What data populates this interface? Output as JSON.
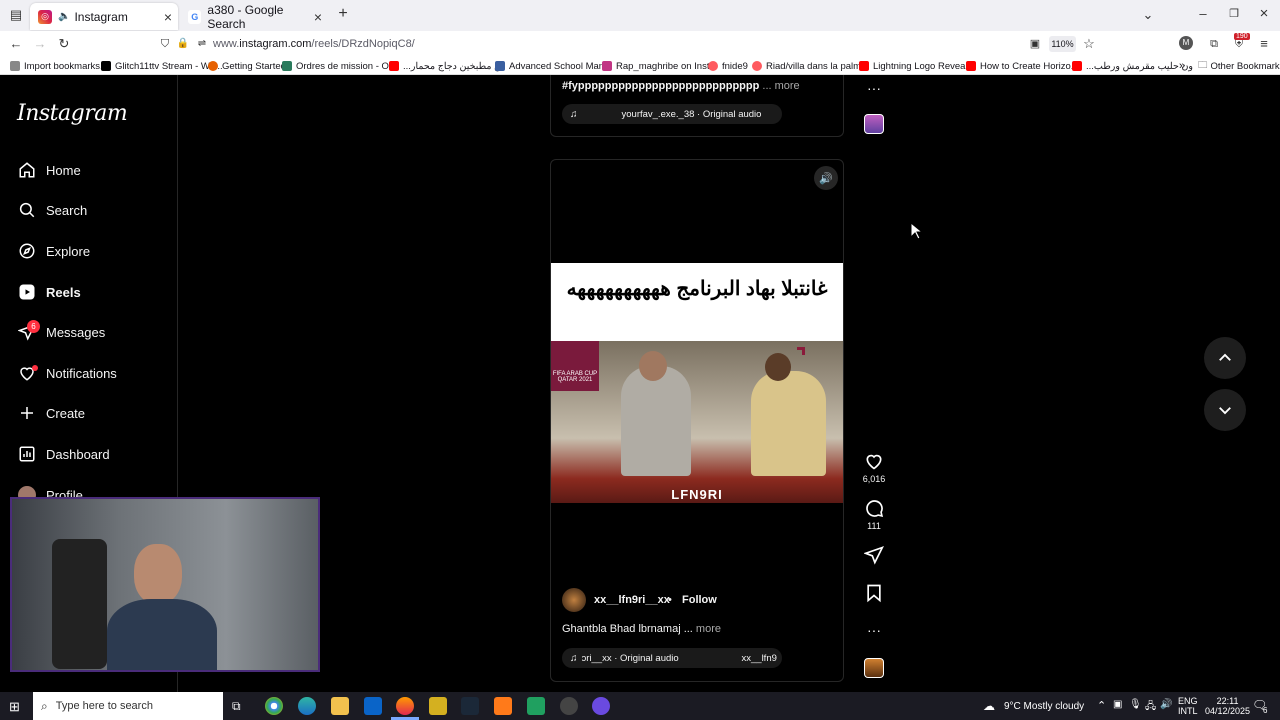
{
  "browser": {
    "tabs": [
      {
        "label": "Instagram",
        "active": true
      },
      {
        "label": "a380 - Google Search",
        "active": false
      }
    ],
    "url_prefix": "www.",
    "url_host": "instagram.com",
    "url_path": "/reels/DRzdNopiqC8/",
    "zoom": "110%",
    "bookmarks": [
      "Import bookmarks...",
      "Glitch11ttv Stream - Wa...",
      "Getting Started",
      "Ordres de mission - O...",
      "...ين مطبخين دجاج محمار",
      "Advanced School Man...",
      "Rap_maghribe on Inst...",
      "fnide9",
      "Riad/villa dans la palm...",
      "Lightning Logo Reveal...",
      "How to Create Horizo...",
      "...ون حليب مقرمش ورطب"
    ],
    "other_bookmarks": "Other Bookmarks",
    "extension_badge": "190",
    "profile_initial": "M"
  },
  "sidebar": {
    "logo": "Instagram",
    "items": [
      {
        "label": "Home",
        "icon": "home-icon"
      },
      {
        "label": "Search",
        "icon": "search-icon"
      },
      {
        "label": "Explore",
        "icon": "compass-icon"
      },
      {
        "label": "Reels",
        "icon": "reels-icon"
      },
      {
        "label": "Messages",
        "icon": "messenger-icon",
        "badge": "6"
      },
      {
        "label": "Notifications",
        "icon": "heart-icon"
      },
      {
        "label": "Create",
        "icon": "plus-icon"
      },
      {
        "label": "Dashboard",
        "icon": "dashboard-icon"
      },
      {
        "label": "Profile",
        "icon": "avatar-icon"
      }
    ]
  },
  "prev_reel": {
    "caption": "#fyppppppppppppppppppppppppppp",
    "more": "... more",
    "audio": "yourfav_.exe._38 · Original audio"
  },
  "reel": {
    "video_title": "غانتبلا بهاد البرنامج ههههههههههه",
    "watermark": "LFN9RI",
    "badge_text": "FIFA ARAB CUP QATAR 2021",
    "username": "xx__lfn9ri__xx",
    "separator": "•",
    "follow": "Follow",
    "caption": "Ghantbla Bhad lbrnamaj ...",
    "more": "more",
    "audio_left": "ɔri__xx · Original audio",
    "audio_right": "xx__lfn9",
    "likes": "6,016",
    "comments": "111"
  },
  "taskbar": {
    "search_placeholder": "Type here to search",
    "weather": "9°C  Mostly cloudy",
    "lang_top": "ENG",
    "lang_bottom": "INTL",
    "time": "22:11",
    "date": "04/12/2025",
    "notif_count": "6"
  },
  "colors": {
    "accent_red": "#ff3040",
    "bg": "#000000",
    "browser_chrome": "#f0f0f4"
  }
}
